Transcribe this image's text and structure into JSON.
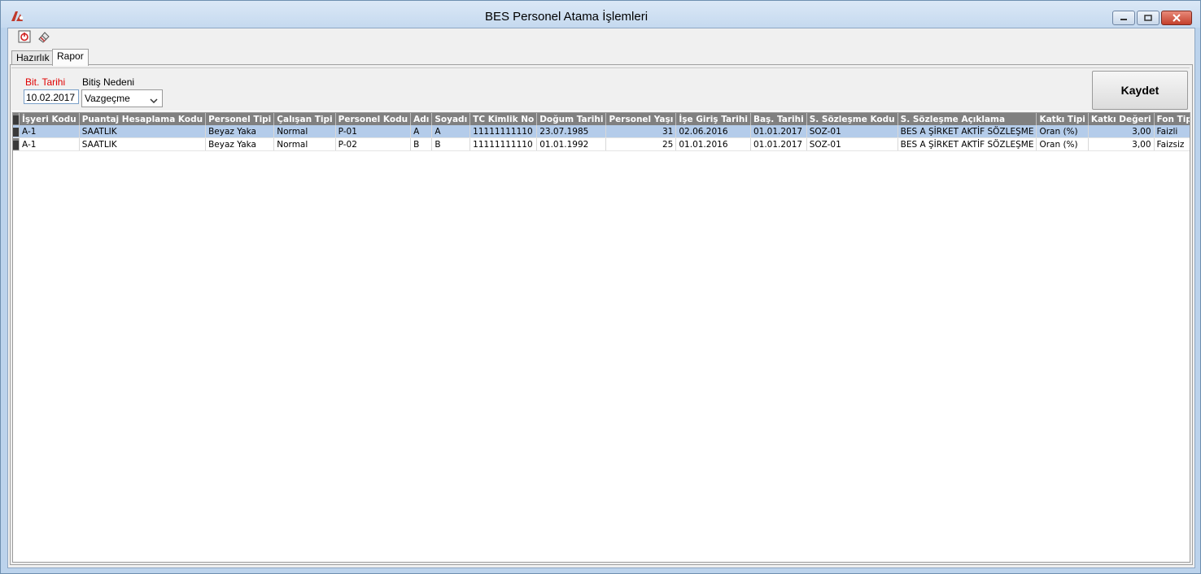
{
  "window": {
    "title": "BES Personel Atama İşlemleri",
    "accent": "#c0392b"
  },
  "toolbar": {
    "icons": [
      "power-icon",
      "eraser-icon"
    ]
  },
  "tabs": [
    {
      "label": "Hazırlık",
      "active": false
    },
    {
      "label": "Rapor",
      "active": true
    }
  ],
  "filters": {
    "bit_tarihi_label": "Bit. Tarihi",
    "bit_tarihi_value": "10.02.2017",
    "bitis_nedeni_label": "Bitiş Nedeni",
    "bitis_nedeni_value": "Vazgeçme"
  },
  "actions": {
    "save_label": "Kaydet"
  },
  "grid": {
    "columns": [
      "İşyeri Kodu",
      "Puantaj Hesaplama Kodu",
      "Personel Tipi",
      "Çalışan Tipi",
      "Personel Kodu",
      "Adı",
      "Soyadı",
      "TC Kimlik No",
      "Doğum Tarihi",
      "Personel Yaşı",
      "İşe Giriş Tarihi",
      "Baş. Tarihi",
      "S. Sözleşme Kodu",
      "S. Sözleşme Açıklama",
      "Katkı Tipi",
      "Katkı Değeri",
      "Fon Tipi"
    ],
    "rows": [
      {
        "selected": true,
        "cells": [
          "A-1",
          "SAATLIK",
          "Beyaz Yaka",
          "Normal",
          "P-01",
          "A",
          "A",
          "11111111110",
          "23.07.1985",
          "31",
          "02.06.2016",
          "01.01.2017",
          "SOZ-01",
          "BES A ŞİRKET AKTİF SÖZLEŞME",
          "Oran (%)",
          "3,00",
          "Faizli"
        ]
      },
      {
        "selected": false,
        "cells": [
          "A-1",
          "SAATLIK",
          "Beyaz Yaka",
          "Normal",
          "P-02",
          "B",
          "B",
          "11111111110",
          "01.01.1992",
          "25",
          "01.01.2016",
          "01.01.2017",
          "SOZ-01",
          "BES A ŞİRKET AKTİF SÖZLEŞME",
          "Oran (%)",
          "3,00",
          "Faizsiz"
        ]
      }
    ]
  }
}
